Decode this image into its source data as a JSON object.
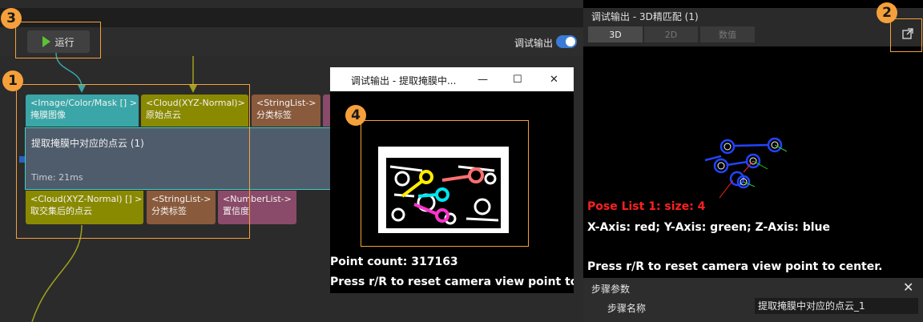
{
  "toolbar": {
    "run_label": "运行",
    "debug_output_label": "调试输出"
  },
  "node": {
    "inputs": [
      {
        "type": "<Image/Color/Mask [] >",
        "name": "掩膜图像",
        "color": "#3aa6a8"
      },
      {
        "type": "<Cloud(XYZ-Normal)>",
        "name": "原始点云",
        "color": "#8a8a00"
      },
      {
        "type": "<StringList->",
        "name": "分类标签",
        "color": "#8a5a3c"
      }
    ],
    "title": "提取掩膜中对应的点云 (1)",
    "time": "Time: 21ms",
    "outputs": [
      {
        "type": "<Cloud(XYZ-Normal) [] >",
        "name": "取交集后的点云",
        "color": "#8a8a00"
      },
      {
        "type": "<StringList->",
        "name": "分类标签",
        "color": "#8a5a3c"
      },
      {
        "type": "<NumberList->",
        "name": "置信度",
        "color": "#8a4a6a"
      }
    ]
  },
  "badges": [
    "1",
    "2",
    "3",
    "4"
  ],
  "float_window": {
    "title": "调试输出 - 提取掩膜中...",
    "minimize": "—",
    "maximize": "☐",
    "close": "✕",
    "point_count": "Point count: 317163",
    "reset_hint": "Press r/R to reset camera view point to c"
  },
  "debug_panel": {
    "title": "调试输出 - 3D精匹配 (1)",
    "tabs": [
      "3D",
      "2D",
      "数值"
    ],
    "active_tab": "3D",
    "pose_list": "Pose List 1: size: 4",
    "axis_legend": "X-Axis: red; Y-Axis: green; Z-Axis: blue",
    "reset_hint": "Press r/R to reset camera view point to center."
  },
  "step_params": {
    "title": "步骤参数",
    "close": "✕",
    "name_label": "步骤名称",
    "name_value": "提取掩膜中对应的点云_1"
  },
  "colors": {
    "accent": "#f5a03a",
    "node_border": "#3ad0c4",
    "toggle": "#3a7bd5"
  }
}
